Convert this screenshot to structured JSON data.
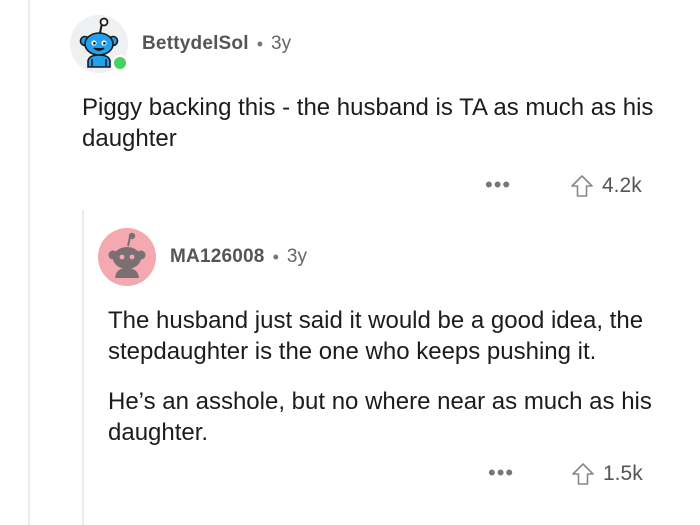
{
  "comments": [
    {
      "username": "BettydelSol",
      "separator": "•",
      "age": "3y",
      "avatar_color": "#24a0ed",
      "online": true,
      "paragraphs": [
        "Piggy backing this - the husband is TA as much as his daughter"
      ],
      "more_label": "•••",
      "score": "4.2k"
    },
    {
      "username": "MA126008",
      "separator": "•",
      "age": "3y",
      "avatar_color": "#f4a8b0",
      "online": false,
      "paragraphs": [
        "The husband just said it would be a good idea, the stepdaughter is the one who keeps pushing it.",
        "He’s an asshole, but no where near as much as his daughter."
      ],
      "more_label": "•••",
      "score": "1.5k"
    }
  ]
}
